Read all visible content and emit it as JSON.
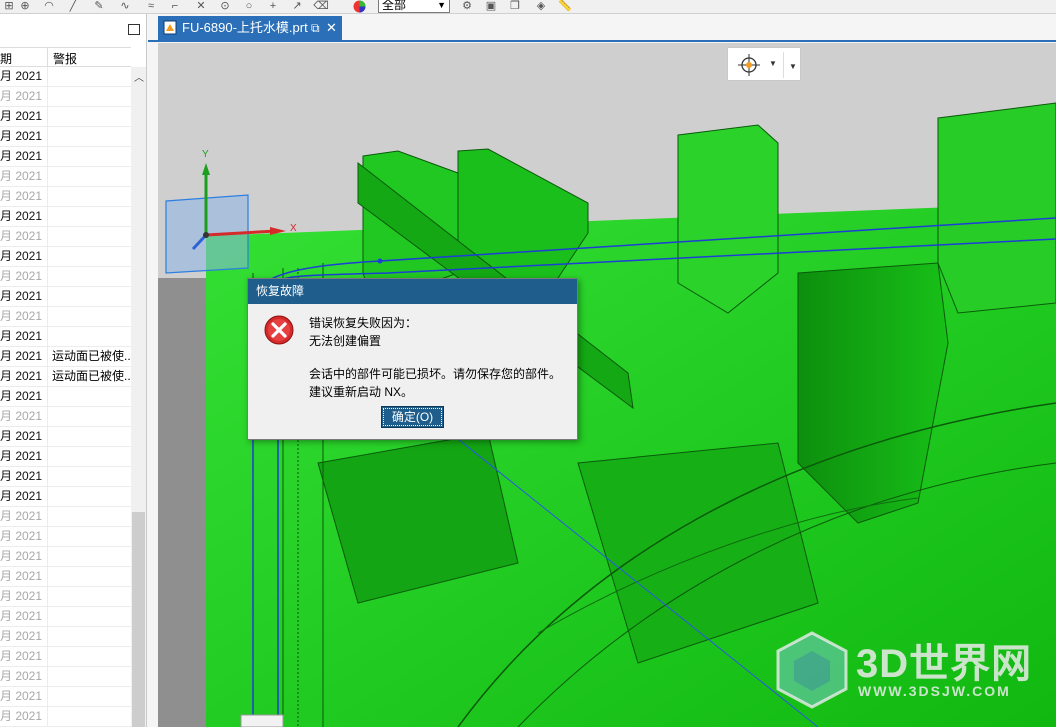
{
  "toolbar": {
    "filter_value": "全部",
    "icons": [
      "snap-icon",
      "grid-icon",
      "arc-icon",
      "line-icon",
      "pen-icon",
      "curve-icon",
      "spline-icon",
      "corner-icon",
      "intersection-icon",
      "center-icon",
      "tangent-icon",
      "point-icon",
      "pin-icon",
      "eraser-icon",
      "color-wheel-icon",
      "settings-icon",
      "box-icon",
      "copy-icon",
      "layer-icon",
      "measure-icon"
    ]
  },
  "left_panel": {
    "columns": [
      "期",
      "警报"
    ],
    "rows": [
      {
        "date": "月 2021",
        "alarm": "",
        "state": "dark"
      },
      {
        "date": "月 2021",
        "alarm": "",
        "state": "dim"
      },
      {
        "date": "月 2021",
        "alarm": "",
        "state": "dark"
      },
      {
        "date": "月 2021",
        "alarm": "",
        "state": "dark"
      },
      {
        "date": "月 2021",
        "alarm": "",
        "state": "dark"
      },
      {
        "date": "月 2021",
        "alarm": "",
        "state": "dim"
      },
      {
        "date": "月 2021",
        "alarm": "",
        "state": "dim"
      },
      {
        "date": "月 2021",
        "alarm": "",
        "state": "dark"
      },
      {
        "date": "月 2021",
        "alarm": "",
        "state": "dim"
      },
      {
        "date": "月 2021",
        "alarm": "",
        "state": "dark"
      },
      {
        "date": "月 2021",
        "alarm": "",
        "state": "dim"
      },
      {
        "date": "月 2021",
        "alarm": "",
        "state": "dark"
      },
      {
        "date": "月 2021",
        "alarm": "",
        "state": "dim"
      },
      {
        "date": "月 2021",
        "alarm": "",
        "state": "dark"
      },
      {
        "date": "月 2021",
        "alarm": "运动面已被使...",
        "state": "dark"
      },
      {
        "date": "月 2021",
        "alarm": "运动面已被使...",
        "state": "dark"
      },
      {
        "date": "月 2021",
        "alarm": "",
        "state": "dark"
      },
      {
        "date": "月 2021",
        "alarm": "",
        "state": "dim"
      },
      {
        "date": "月 2021",
        "alarm": "",
        "state": "dark"
      },
      {
        "date": "月 2021",
        "alarm": "",
        "state": "dark"
      },
      {
        "date": "月 2021",
        "alarm": "",
        "state": "dark"
      },
      {
        "date": "月 2021",
        "alarm": "",
        "state": "dark"
      },
      {
        "date": "月 2021",
        "alarm": "",
        "state": "dim"
      },
      {
        "date": "月 2021",
        "alarm": "",
        "state": "dim"
      },
      {
        "date": "月 2021",
        "alarm": "",
        "state": "dim"
      },
      {
        "date": "月 2021",
        "alarm": "",
        "state": "dim"
      },
      {
        "date": "月 2021",
        "alarm": "",
        "state": "dim"
      },
      {
        "date": "月 2021",
        "alarm": "",
        "state": "dim"
      },
      {
        "date": "月 2021",
        "alarm": "",
        "state": "dim"
      },
      {
        "date": "月 2021",
        "alarm": "",
        "state": "dim"
      },
      {
        "date": "月 2021",
        "alarm": "",
        "state": "dim"
      },
      {
        "date": "月 2021",
        "alarm": "",
        "state": "dim"
      },
      {
        "date": "月 2021",
        "alarm": "",
        "state": "dim"
      }
    ]
  },
  "tab": {
    "title": "FU-6890-上托水模.prt",
    "restore_glyph": "⧉",
    "close_glyph": "✕"
  },
  "viewport": {
    "axis_y_label": "Y",
    "axis_x_label": "X",
    "part_color": "#1fd21f",
    "background_color": "#cfcfcf"
  },
  "dialog": {
    "title": "恢复故障",
    "line1": "错误恢复失败因为：",
    "line2": "无法创建偏置",
    "line3": "会话中的部件可能已损坏。请勿保存您的部件。",
    "line4": "建议重新启动 NX。",
    "ok_label": "确定(O)"
  },
  "watermark": {
    "name": "3D世界网",
    "url": "WWW.3DSJW.COM"
  },
  "colors": {
    "accent": "#2a6fb8",
    "dialog_title": "#1f5e8c",
    "error_red": "#d42a2a"
  }
}
